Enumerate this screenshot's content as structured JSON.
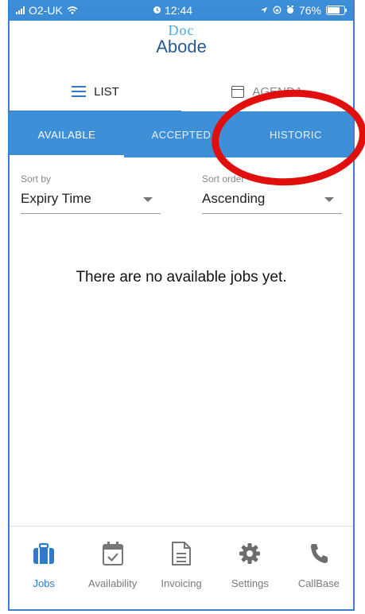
{
  "status_bar": {
    "carrier": "O2-UK",
    "time": "12:44",
    "battery": "76%"
  },
  "header": {
    "logo_top": "Doc",
    "logo_bottom": "Abode"
  },
  "view_tabs": [
    {
      "label": "LIST",
      "active": true
    },
    {
      "label": "AGENDA",
      "active": false
    }
  ],
  "job_tabs": [
    {
      "label": "AVAILABLE",
      "active": true
    },
    {
      "label": "ACCEPTED",
      "active": false
    },
    {
      "label": "HISTORIC",
      "active": false
    }
  ],
  "sort": {
    "sort_by_label": "Sort by",
    "sort_by_value": "Expiry Time",
    "sort_order_label": "Sort order",
    "sort_order_value": "Ascending"
  },
  "empty_message": "There are no available jobs yet.",
  "bottom_nav": [
    {
      "label": "Jobs",
      "icon": "briefcase-icon",
      "active": true
    },
    {
      "label": "Availability",
      "icon": "calendar-check-icon",
      "active": false
    },
    {
      "label": "Invoicing",
      "icon": "document-icon",
      "active": false
    },
    {
      "label": "Settings",
      "icon": "gear-icon",
      "active": false
    },
    {
      "label": "CallBase",
      "icon": "phone-icon",
      "active": false
    }
  ],
  "colors": {
    "accent": "#3d8fd8",
    "annotation": "#e10e0e"
  }
}
